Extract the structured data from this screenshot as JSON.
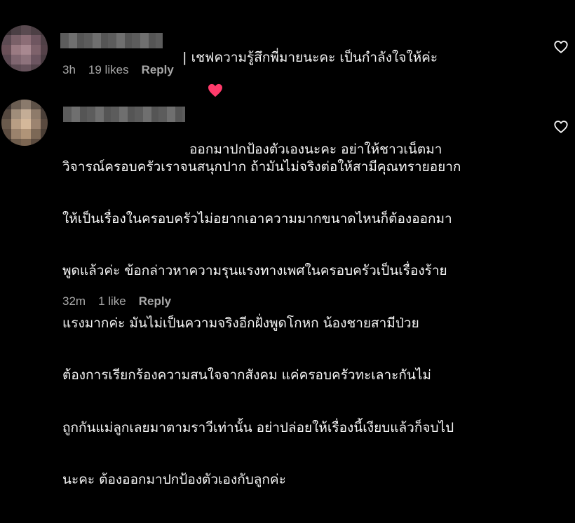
{
  "comments": [
    {
      "text": "| เชฟความรู้สึกพี่มายนะคะ เป็นกำลังใจให้ค่ะ",
      "emoji": "heart-emoji",
      "time": "3h",
      "likes": "19 likes",
      "reply": "Reply"
    },
    {
      "lines": [
        "ออกมาปกป้องตัวเองนะคะ อย่าให้ชาวเน็ตมา",
        "วิจารณ์ครอบครัวเราจนสนุกปาก ถ้ามันไม่จริงต่อให้สามีคุณทรายอยาก",
        "ให้เป็นเรื่องในครอบครัวไม่อยากเอาความมากขนาดไหนก็ต้องออกมา",
        "พูดแล้วค่ะ ข้อกล่าวหาความรุนแรงทางเพศในครอบครัวเป็นเรื่องร้าย",
        "แรงมากค่ะ มันไม่เป็นความจริงอีกฝั่งพูดโกหก น้องชายสามีป่วย",
        "ต้องการเรียกร้องความสนใจจากสังคม แค่ครอบครัวทะเลาะกันไม่",
        "ถูกกันแม่ลูกเลยมาตามราวีเท่านั้น อย่าปล่อยให้เรื่องนี้เงียบแล้วก็จบไป",
        "นะคะ ต้องออกมาปกป้องตัวเองกับลูกค่ะ"
      ],
      "time": "32m",
      "likes": "1 like",
      "reply": "Reply"
    }
  ],
  "icons": {
    "like": "heart-outline-icon"
  },
  "colors": {
    "background": "#000000",
    "text": "#f5f5f5",
    "meta": "#a8a8a8",
    "emoji_heart": "#ff3b6b"
  }
}
